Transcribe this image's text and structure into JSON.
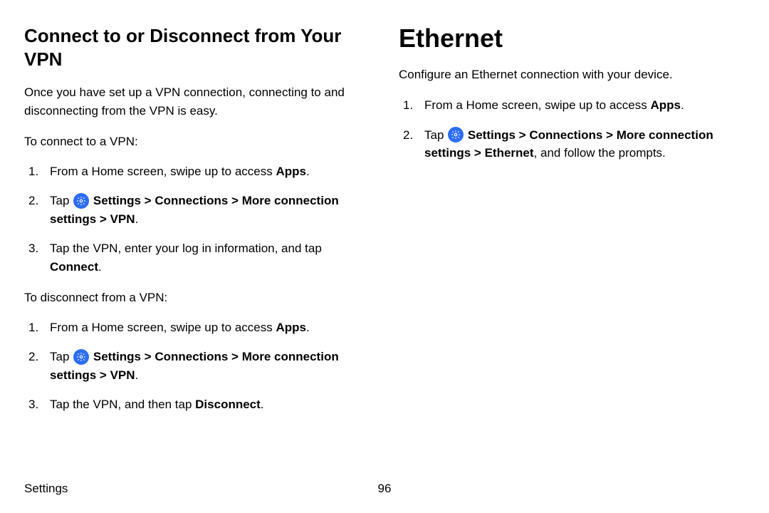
{
  "left": {
    "heading": "Connect to or Disconnect from Your VPN",
    "intro": "Once you have set up a VPN connection, connecting to and disconnecting from the VPN is easy.",
    "connect_label": "To connect to a VPN:",
    "disconnect_label": "To disconnect from a VPN:",
    "step_home_pre": "From a Home screen, swipe up to access ",
    "step_home_apps": "Apps",
    "step_tap": "Tap ",
    "path_settings": "Settings",
    "path_conn": "Connections",
    "path_more_line1": "More connection",
    "path_settings_line2": "settings",
    "path_vpn": "VPN",
    "step3_connect_pre": "Tap the VPN, enter your log in information, and tap ",
    "step3_connect_bold": "Connect",
    "step3_disconnect_pre": "Tap the VPN, and then tap ",
    "step3_disconnect_bold": "Disconnect"
  },
  "right": {
    "heading": "Ethernet",
    "intro": "Configure an Ethernet connection with your device.",
    "step_home_pre": "From a Home screen, swipe up to access ",
    "step_home_apps": "Apps",
    "step_tap": "Tap ",
    "path_settings": "Settings",
    "path_conn": "Connections",
    "path_more_line1": "More connection",
    "path_settings_line2": "settings",
    "path_ethernet": "Ethernet",
    "step2_tail": ", and follow the prompts."
  },
  "footer": {
    "section": "Settings",
    "page": "96"
  },
  "glyphs": {
    "chevron": ">",
    "period": "."
  }
}
